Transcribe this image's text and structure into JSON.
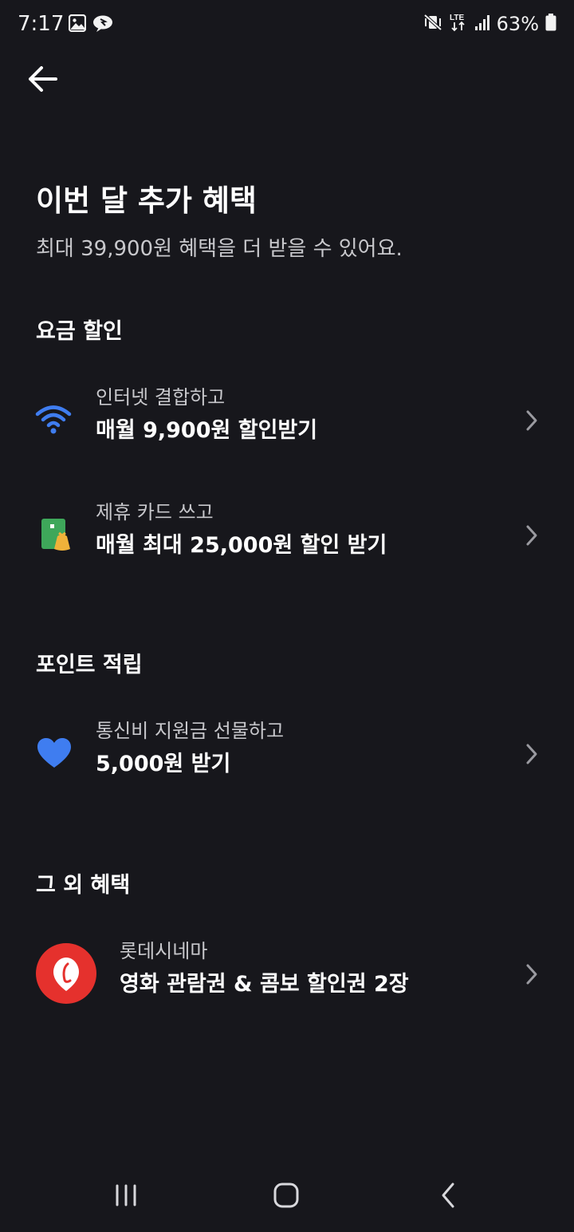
{
  "status_bar": {
    "time": "7:17",
    "battery": "63%",
    "left_icons": [
      "gallery-icon",
      "chat-bubble-icon"
    ],
    "right_icons": [
      "vibrate-mute-icon",
      "lte-icon",
      "signal-icon",
      "battery-icon"
    ]
  },
  "header": {
    "back_icon": "arrow-left-icon",
    "title": "이번 달 추가 혜택",
    "subtitle": "최대 39,900원 혜택을 더 받을 수 있어요."
  },
  "sections": {
    "discount": {
      "heading": "요금 할인",
      "items": [
        {
          "icon": "wifi-icon",
          "subtitle": "인터넷 결합하고",
          "title": "매월 9,900원 할인받기"
        },
        {
          "icon": "card-coin-icon",
          "subtitle": "제휴 카드 쓰고",
          "title": "매월 최대 25,000원 할인 받기"
        }
      ]
    },
    "points": {
      "heading": "포인트 적립",
      "items": [
        {
          "icon": "heart-icon",
          "subtitle": "통신비 지원금 선물하고",
          "title": "5,000원 받기"
        }
      ]
    },
    "other": {
      "heading": "그 외 혜택",
      "items": [
        {
          "icon": "lotte-cinema-logo",
          "subtitle": "롯데시네마",
          "title": "영화 관람권 & 콤보 할인권 2장"
        }
      ]
    }
  },
  "nav_bar": {
    "icons": [
      "recent-apps-icon",
      "home-icon",
      "back-icon"
    ]
  },
  "colors": {
    "background": "#17171c",
    "accent_blue": "#3f7df0",
    "card_green": "#3ea75a",
    "lotte_red": "#e5312d"
  }
}
